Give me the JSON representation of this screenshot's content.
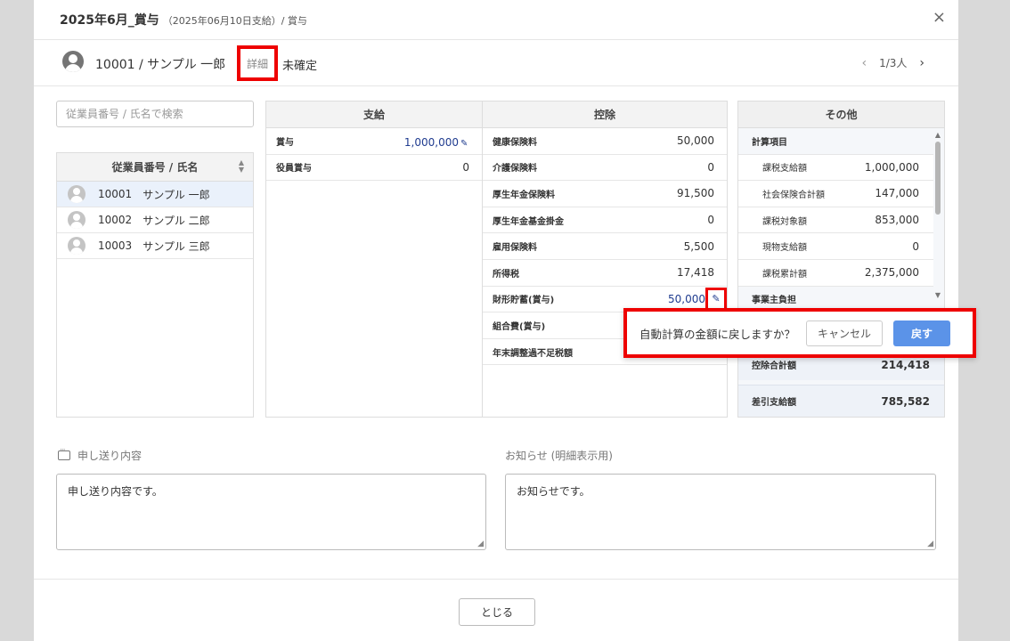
{
  "header": {
    "title": "2025年6月_賞与",
    "subtitle": "（2025年06月10日支給）/ 賞与",
    "close_icon": "×"
  },
  "employee_bar": {
    "name": "10001 / サンプル 一郎",
    "detail_link": "詳細",
    "status": "未確定",
    "pager": {
      "prev": "‹",
      "position": "1/3人",
      "next": "›"
    }
  },
  "search": {
    "placeholder": "従業員番号 / 氏名で検索",
    "value": ""
  },
  "employee_list": {
    "header": "従業員番号 / 氏名",
    "sort_icon": "▲▼",
    "rows": [
      {
        "id": "10001",
        "name": "サンプル 一郎",
        "selected": true
      },
      {
        "id": "10002",
        "name": "サンプル 二郎"
      },
      {
        "id": "10003",
        "name": "サンプル 三郎"
      }
    ]
  },
  "payment": {
    "header": "支給",
    "rows": [
      {
        "label": "賞与",
        "value": "1,000,000",
        "edited": true
      },
      {
        "label": "役員賞与",
        "value": "0"
      }
    ]
  },
  "deduction": {
    "header": "控除",
    "rows": [
      {
        "label": "健康保険料",
        "value": "50,000"
      },
      {
        "label": "介護保険料",
        "value": "0"
      },
      {
        "label": "厚生年金保険料",
        "value": "91,500"
      },
      {
        "label": "厚生年金基金掛金",
        "value": "0"
      },
      {
        "label": "雇用保険料",
        "value": "5,500"
      },
      {
        "label": "所得税",
        "value": "17,418"
      },
      {
        "label": "財形貯蓄(賞与)",
        "value": "50,000",
        "edited": true
      },
      {
        "label": "組合費(賞与)",
        "value": ""
      },
      {
        "label": "年末調整過不足税額",
        "value": ""
      }
    ]
  },
  "other": {
    "header": "その他",
    "rows": [
      {
        "label": "計算項目",
        "value": "",
        "category": true
      },
      {
        "label": "課税支給額",
        "value": "1,000,000"
      },
      {
        "label": "社会保険合計額",
        "value": "147,000"
      },
      {
        "label": "課税対象額",
        "value": "853,000"
      },
      {
        "label": "現物支給額",
        "value": "0"
      },
      {
        "label": "課税累計額",
        "value": "2,375,000"
      },
      {
        "label": "事業主負担",
        "value": "",
        "category": true
      }
    ],
    "totals": [
      {
        "label": "控除合計額",
        "value": "214,418"
      },
      {
        "label": "差引支給額",
        "value": "785,582"
      }
    ]
  },
  "popover": {
    "message": "自動計算の金額に戻しますか？",
    "cancel_label": "キャンセル",
    "revert_label": "戻す"
  },
  "memo": {
    "label": "申し送り内容",
    "value": "申し送り内容です。"
  },
  "notice": {
    "label": "お知らせ (明細表示用)",
    "value": "お知らせです。"
  },
  "footer": {
    "close_label": "とじる"
  },
  "colors": {
    "accent": "#5b93e8",
    "highlight": "#e00000",
    "edited_value": "#1f3b8f",
    "selected_row": "#eaf1fb"
  },
  "icons": {
    "edit": "pencil-icon",
    "memo": "chat-icon",
    "user": "user-avatar-icon"
  }
}
